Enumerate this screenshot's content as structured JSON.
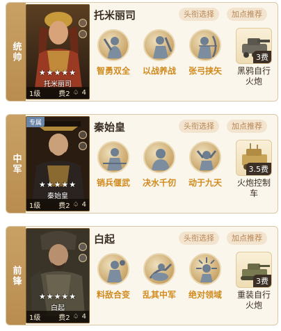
{
  "cards": [
    {
      "role": "统帅",
      "hero": {
        "name": "托米丽司",
        "portrait_name": "托米丽司",
        "stars": "★★★★★",
        "level": "1级",
        "cost": "费2",
        "tag": "4",
        "exclusive": ""
      },
      "buttons": {
        "title": "头衔选择",
        "points": "加点推荐"
      },
      "skills": [
        {
          "label": "智勇双全"
        },
        {
          "label": "以战养战"
        },
        {
          "label": "张弓挟矢"
        }
      ],
      "unit": {
        "name": "黑鸦自行火炮",
        "line1": "黑鸦自行",
        "line2": "火炮",
        "cost": "3费"
      }
    },
    {
      "role": "中军",
      "hero": {
        "name": "秦始皇",
        "portrait_name": "秦始皇",
        "stars": "★★★★★",
        "level": "1级",
        "cost": "费2",
        "tag": "4",
        "exclusive": "专属"
      },
      "buttons": {
        "title": "头衔选择",
        "points": "加点推荐"
      },
      "skills": [
        {
          "label": "销兵偃武"
        },
        {
          "label": "决水千仞"
        },
        {
          "label": "动于九天"
        }
      ],
      "unit": {
        "name": "火炮控制车",
        "line1": "火炮控制",
        "line2": "车",
        "cost": "3.5费"
      }
    },
    {
      "role": "前锋",
      "hero": {
        "name": "白起",
        "portrait_name": "白起",
        "stars": "★★★★★",
        "level": "1级",
        "cost": "费2",
        "tag": "4",
        "exclusive": ""
      },
      "buttons": {
        "title": "头衔选择",
        "points": "加点推荐"
      },
      "skills": [
        {
          "label": "料敌合变"
        },
        {
          "label": "乱其中军"
        },
        {
          "label": "绝对领域"
        }
      ],
      "unit": {
        "name": "重装自行火炮",
        "line1": "重装自行",
        "line2": "火炮",
        "cost": "3费"
      }
    }
  ],
  "colors": {
    "accent": "#d08a1e",
    "strip": "#c9a165",
    "pill_bg": "#f3e4cf",
    "pill_text": "#b88654"
  }
}
